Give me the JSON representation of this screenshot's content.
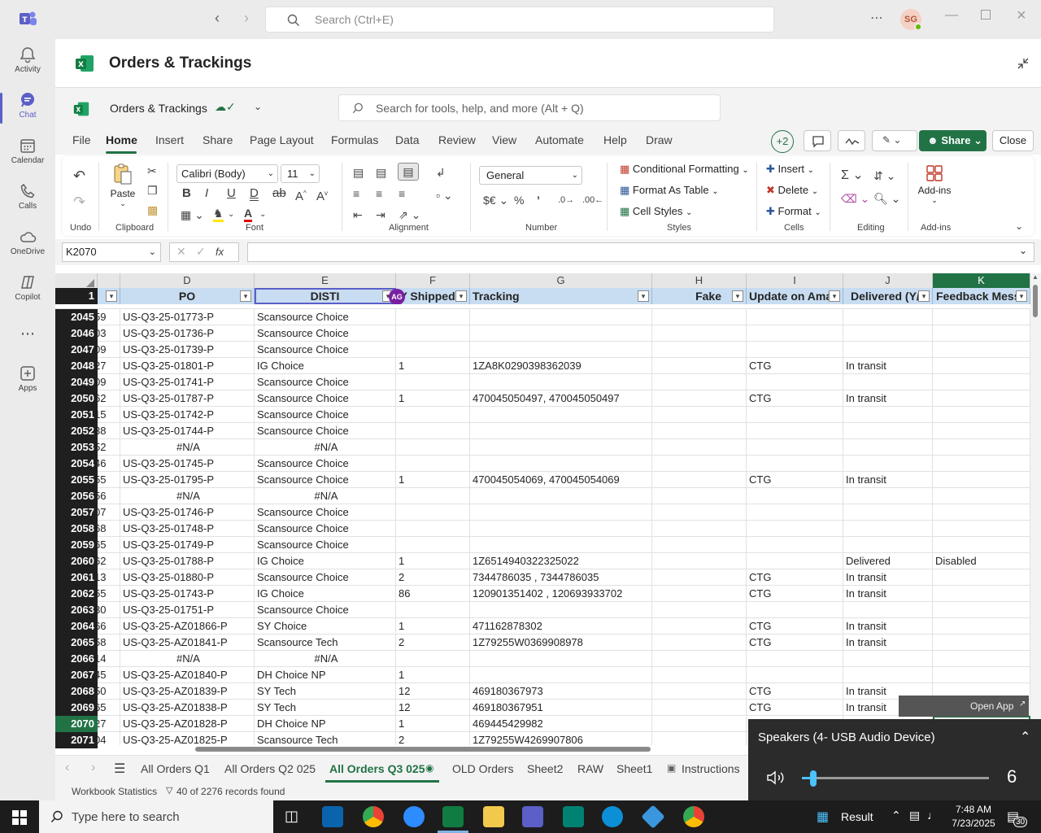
{
  "teams": {
    "search_placeholder": "Search (Ctrl+E)",
    "avatar": "SG"
  },
  "rail": [
    {
      "label": "Activity",
      "icon": "bell-icon"
    },
    {
      "label": "Chat",
      "icon": "chat-icon"
    },
    {
      "label": "Calendar",
      "icon": "calendar-icon"
    },
    {
      "label": "Calls",
      "icon": "phone-icon"
    },
    {
      "label": "OneDrive",
      "icon": "cloud-icon"
    },
    {
      "label": "Copilot",
      "icon": "copilot-icon"
    },
    {
      "label": "Apps",
      "icon": "plus-square-icon"
    }
  ],
  "app": {
    "title": "Orders & Trackings",
    "file_name": "Orders & Trackings",
    "tool_search_placeholder": "Search for tools, help, and more (Alt + Q)"
  },
  "menu": [
    "File",
    "Home",
    "Insert",
    "Share",
    "Page Layout",
    "Formulas",
    "Data",
    "Review",
    "View",
    "Automate",
    "Help",
    "Draw"
  ],
  "menu_right": {
    "badge": "+2",
    "share": "Share",
    "close": "Close"
  },
  "ribbon": {
    "undo": "Undo",
    "clipboard": "Clipboard",
    "paste": "Paste",
    "font_label": "Font",
    "font_name": "Calibri (Body)",
    "font_size": "11",
    "alignment": "Alignment",
    "number": "Number",
    "number_format": "General",
    "styles": "Styles",
    "conditional": "Conditional Formatting",
    "format_table": "Format As Table",
    "cell_styles": "Cell Styles",
    "cells": "Cells",
    "insert": "Insert",
    "delete": "Delete",
    "format": "Format",
    "editing": "Editing",
    "addins": "Add-ins",
    "addins_label": "Add-ins"
  },
  "formula_bar": {
    "name_box": "K2070",
    "fx": "fx",
    "content": ""
  },
  "columns": [
    "D",
    "E",
    "F",
    "G",
    "H",
    "I",
    "J",
    "K"
  ],
  "header_row_num": "1",
  "headers": [
    "PO",
    "DISTI",
    "ITY Shipped",
    "Tracking",
    "Fake",
    "Update on Amaz",
    "Delivered (Y/N",
    "Feedback Messa"
  ],
  "avatar_in_grid": "AG",
  "rows": [
    {
      "n": "2045",
      "c": "59",
      "d": "US-Q3-25-01773-P",
      "e": "Scansource Choice",
      "f": "",
      "g": "",
      "h": "",
      "i": "",
      "j": "",
      "k": ""
    },
    {
      "n": "2046",
      "c": "03",
      "d": "US-Q3-25-01736-P",
      "e": "Scansource Choice",
      "f": "",
      "g": "",
      "h": "",
      "i": "",
      "j": "",
      "k": ""
    },
    {
      "n": "2047",
      "c": "09",
      "d": "US-Q3-25-01739-P",
      "e": "Scansource Choice",
      "f": "",
      "g": "",
      "h": "",
      "i": "",
      "j": "",
      "k": ""
    },
    {
      "n": "2048",
      "c": "27",
      "d": "US-Q3-25-01801-P",
      "e": "IG Choice",
      "f": "1",
      "g": "1ZA8K0290398362039",
      "h": "",
      "i": "CTG",
      "j": "In transit",
      "k": ""
    },
    {
      "n": "2049",
      "c": "09",
      "d": "US-Q3-25-01741-P",
      "e": "Scansource Choice",
      "f": "",
      "g": "",
      "h": "",
      "i": "",
      "j": "",
      "k": ""
    },
    {
      "n": "2050",
      "c": "62",
      "d": "US-Q3-25-01787-P",
      "e": "Scansource Choice",
      "f": "1",
      "g": "470045050497, 470045050497",
      "h": "",
      "i": "CTG",
      "j": "In transit",
      "k": ""
    },
    {
      "n": "2051",
      "c": "15",
      "d": "US-Q3-25-01742-P",
      "e": "Scansource Choice",
      "f": "",
      "g": "",
      "h": "",
      "i": "",
      "j": "",
      "k": ""
    },
    {
      "n": "2052",
      "c": "38",
      "d": "US-Q3-25-01744-P",
      "e": "Scansource Choice",
      "f": "",
      "g": "",
      "h": "",
      "i": "",
      "j": "",
      "k": ""
    },
    {
      "n": "2053",
      "c": "52",
      "d": "#N/A",
      "e": "#N/A",
      "f": "",
      "g": "",
      "h": "",
      "i": "",
      "j": "",
      "k": ""
    },
    {
      "n": "2054",
      "c": "46",
      "d": "US-Q3-25-01745-P",
      "e": "Scansource Choice",
      "f": "",
      "g": "",
      "h": "",
      "i": "",
      "j": "",
      "k": ""
    },
    {
      "n": "2055",
      "c": "55",
      "d": "US-Q3-25-01795-P",
      "e": "Scansource Choice",
      "f": "1",
      "g": "470045054069, 470045054069",
      "h": "",
      "i": "CTG",
      "j": "In transit",
      "k": ""
    },
    {
      "n": "2056",
      "c": "56",
      "d": "#N/A",
      "e": "#N/A",
      "f": "",
      "g": "",
      "h": "",
      "i": "",
      "j": "",
      "k": ""
    },
    {
      "n": "2057",
      "c": "07",
      "d": "US-Q3-25-01746-P",
      "e": "Scansource Choice",
      "f": "",
      "g": "",
      "h": "",
      "i": "",
      "j": "",
      "k": ""
    },
    {
      "n": "2058",
      "c": "68",
      "d": "US-Q3-25-01748-P",
      "e": "Scansource Choice",
      "f": "",
      "g": "",
      "h": "",
      "i": "",
      "j": "",
      "k": ""
    },
    {
      "n": "2059",
      "c": "65",
      "d": "US-Q3-25-01749-P",
      "e": "Scansource Choice",
      "f": "",
      "g": "",
      "h": "",
      "i": "",
      "j": "",
      "k": ""
    },
    {
      "n": "2060",
      "c": "62",
      "d": "US-Q3-25-01788-P",
      "e": "IG Choice",
      "f": "1",
      "g": "1Z6514940322325022",
      "h": "",
      "i": "",
      "j": "Delivered",
      "k": "Disabled"
    },
    {
      "n": "2061",
      "c": "13",
      "d": "US-Q3-25-01880-P",
      "e": "Scansource Choice",
      "f": "2",
      "g": "7344786035 , 7344786035",
      "h": "",
      "i": "CTG",
      "j": "In transit",
      "k": ""
    },
    {
      "n": "2062",
      "c": "55",
      "d": "US-Q3-25-01743-P",
      "e": "IG Choice",
      "f": "86",
      "g": "120901351402 , 120693933702",
      "h": "",
      "i": "CTG",
      "j": "In transit",
      "k": ""
    },
    {
      "n": "2063",
      "c": "30",
      "d": "US-Q3-25-01751-P",
      "e": "Scansource Choice",
      "f": "",
      "g": "",
      "h": "",
      "i": "",
      "j": "",
      "k": ""
    },
    {
      "n": "2064",
      "c": "66",
      "d": "US-Q3-25-AZ01866-P",
      "e": "SY Choice",
      "f": "1",
      "g": "471162878302",
      "h": "",
      "i": "CTG",
      "j": "In transit",
      "k": ""
    },
    {
      "n": "2065",
      "c": "58",
      "d": "US-Q3-25-AZ01841-P",
      "e": "Scansource Tech",
      "f": "2",
      "g": "1Z79255W0369908978",
      "h": "",
      "i": "CTG",
      "j": "In transit",
      "k": ""
    },
    {
      "n": "2066",
      "c": "14",
      "d": "#N/A",
      "e": "#N/A",
      "f": "",
      "g": "",
      "h": "",
      "i": "",
      "j": "",
      "k": ""
    },
    {
      "n": "2067",
      "c": "45",
      "d": "US-Q3-25-AZ01840-P",
      "e": "DH Choice NP",
      "f": "1",
      "g": "",
      "h": "",
      "i": "",
      "j": "",
      "k": ""
    },
    {
      "n": "2068",
      "c": "50",
      "d": "US-Q3-25-AZ01839-P",
      "e": "SY Tech",
      "f": "12",
      "g": "469180367973",
      "h": "",
      "i": "CTG",
      "j": "In transit",
      "k": ""
    },
    {
      "n": "2069",
      "c": "65",
      "d": "US-Q3-25-AZ01838-P",
      "e": "SY Tech",
      "f": "12",
      "g": "469180367951",
      "h": "",
      "i": "CTG",
      "j": "In transit",
      "k": ""
    },
    {
      "n": "2070",
      "c": "27",
      "d": "US-Q3-25-AZ01828-P",
      "e": "DH Choice NP",
      "f": "1",
      "g": "469445429982",
      "h": "",
      "i": "",
      "j": "",
      "k": ""
    },
    {
      "n": "2071",
      "c": "04",
      "d": "US-Q3-25-AZ01825-P",
      "e": "Scansource Tech",
      "f": "2",
      "g": "1Z79255W4269907806",
      "h": "",
      "i": "",
      "j": "",
      "k": ""
    }
  ],
  "sheets": [
    "All Orders Q1",
    "All Orders Q2 025",
    "All Orders Q3 025",
    "OLD Orders",
    "Sheet2",
    "RAW",
    "Sheet1",
    "Instructions"
  ],
  "status": {
    "stats": "Workbook Statistics",
    "records": "40 of 2276 records found"
  },
  "open_app": "Open App",
  "volume": {
    "device": "Speakers (4- USB Audio Device)",
    "level": "6",
    "fraction": 0.06
  },
  "taskbar": {
    "search_placeholder": "Type here to search",
    "result": "Result",
    "time": "7:48 AM",
    "date": "7/23/2025",
    "notif": "30"
  }
}
